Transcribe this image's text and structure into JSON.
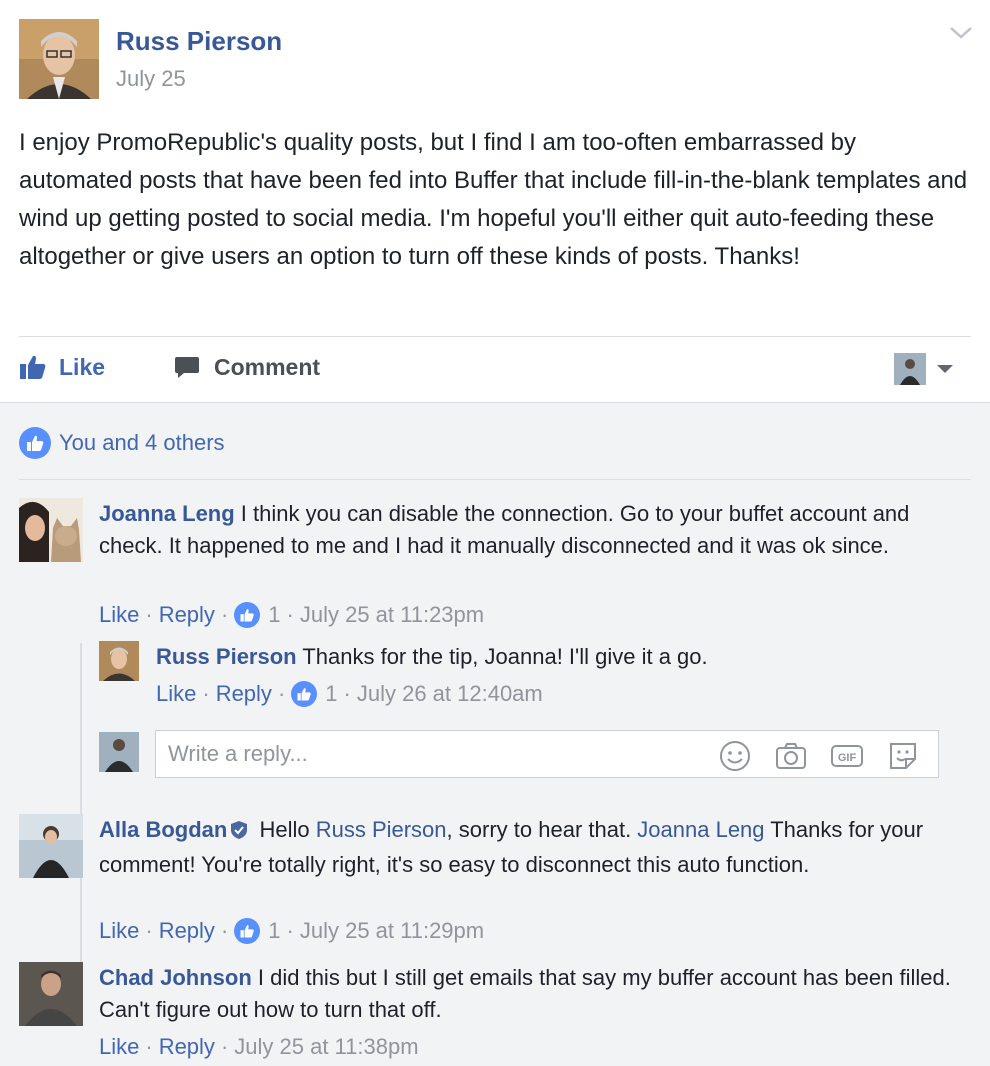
{
  "post": {
    "author": "Russ Pierson",
    "date": "July 25",
    "text": "I enjoy PromoRepublic's quality posts, but I find I am too-often embarrassed by automated posts that have been fed into Buffer that include fill-in-the-blank templates and wind up getting posted to social media. I'm hopeful you'll either quit auto-feeding these altogether or give users an option to turn off these kinds of posts. Thanks!",
    "actions": {
      "like": "Like",
      "comment": "Comment"
    }
  },
  "reactions": {
    "summary": "You and 4 others"
  },
  "comments": [
    {
      "name": "Joanna Leng",
      "text": " I think you can disable the connection. Go to your buffet account and check. It happened to me and I had it manually disconnected and it was ok since.",
      "like": "Like",
      "reply": "Reply",
      "likes": "1",
      "time": "July 25 at 11:23pm"
    },
    {
      "name": "Russ Pierson",
      "text": " Thanks for the tip, Joanna! I'll give it a go.",
      "like": "Like",
      "reply": "Reply",
      "likes": "1",
      "time": "July 26 at 12:40am"
    },
    {
      "name": "Alla Bogdan",
      "text_a": " Hello ",
      "mention_1": "Russ Pierson",
      "text_b": ", sorry to hear that. ",
      "mention_2": "Joanna Leng",
      "text_c": " Thanks for your comment! You're totally right, it's so easy to disconnect this auto function.",
      "like": "Like",
      "reply": "Reply",
      "likes": "1",
      "time": "July 25 at 11:29pm"
    },
    {
      "name": "Chad Johnson",
      "text": " I did this but I still get emails that say my buffer account has been filled. Can't figure out how to turn that off.",
      "like": "Like",
      "reply": "Reply",
      "time": "July 25 at 11:38pm"
    }
  ],
  "reply_box": {
    "placeholder": "Write a reply..."
  },
  "colors": {
    "link": "#385898",
    "action": "#4267b2",
    "meta": "#90949c",
    "comments_bg": "#f2f3f5",
    "like_badge": "#5890ff"
  }
}
